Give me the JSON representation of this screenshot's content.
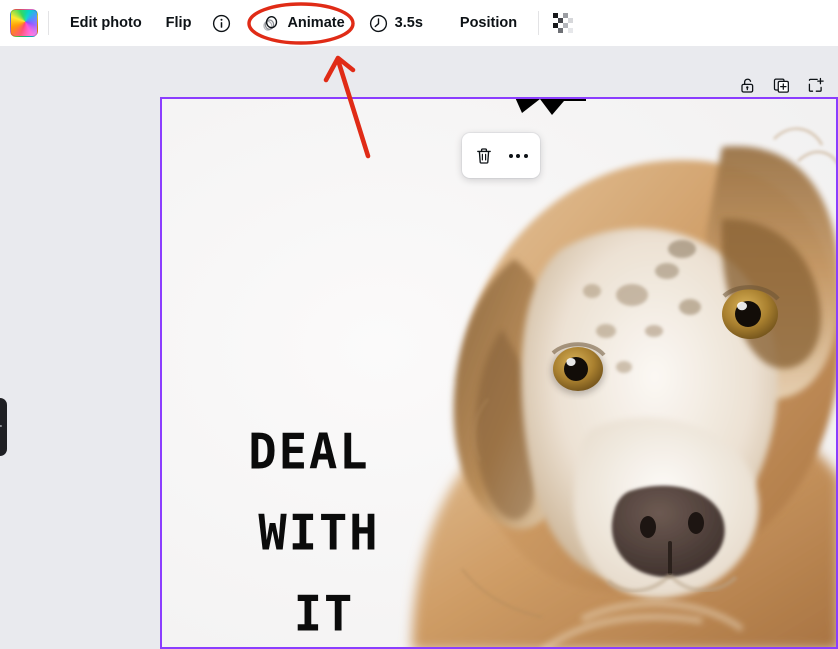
{
  "app": {
    "background_color": "#e9eaee",
    "canvas_background": "#f7f6f6",
    "selection_border_color": "#8b3dff",
    "annotation_color": "#e02b16"
  },
  "toolbar": {
    "color_swatch": {
      "name": "color-swatch",
      "tooltip": "Color"
    },
    "items": [
      {
        "id": "edit-photo",
        "label": "Edit photo",
        "icon": null
      },
      {
        "id": "flip",
        "label": "Flip",
        "icon": null
      },
      {
        "id": "info",
        "label": "",
        "icon": "info-circle-icon"
      },
      {
        "id": "animate",
        "label": "Animate",
        "icon": "animate-icon",
        "highlighted": true
      },
      {
        "id": "duration",
        "label": "3.5s",
        "icon": "clock-icon"
      },
      {
        "id": "position",
        "label": "Position",
        "icon": null
      },
      {
        "id": "transparency",
        "label": "",
        "icon": "transparency-checkerboard-icon"
      }
    ]
  },
  "page_actions": [
    {
      "id": "lock",
      "label": "Unlock",
      "icon": "unlock-icon"
    },
    {
      "id": "duplicate",
      "label": "Duplicate page",
      "icon": "duplicate-page-icon"
    },
    {
      "id": "add-page",
      "label": "Add page",
      "icon": "add-page-icon"
    }
  ],
  "element_toolbar": [
    {
      "id": "delete",
      "label": "Delete",
      "icon": "trash-icon"
    },
    {
      "id": "more",
      "label": "More options",
      "icon": "more-dots-icon"
    }
  ],
  "canvas": {
    "image_alt": "Close-up photo of an Australian Shepherd dog on a white background",
    "overlay_text": {
      "line1": "DEAL",
      "line2": "WITH",
      "line3": "IT"
    }
  },
  "annotations": {
    "ellipse_target": "Animate",
    "arrow_label": "points to Animate button"
  },
  "left_panel_handle": {
    "label": "Collapse side panel"
  }
}
